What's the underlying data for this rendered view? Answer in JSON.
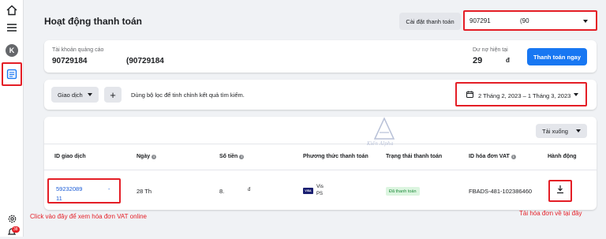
{
  "colors": {
    "accent": "#1877f2",
    "highlight": "#e41e26",
    "status_green": "#1d8a3a",
    "link": "#1a5bd6"
  },
  "sidebar": {
    "icons": [
      "home-icon",
      "menu-icon",
      "avatar",
      "billing-icon",
      "settings-icon",
      "notifications-icon"
    ],
    "avatar_letter": "K",
    "notification_count": "38"
  },
  "header": {
    "title": "Hoạt động thanh toán",
    "settings_label": "Cài đặt thanh toán",
    "account_select_id": "907291",
    "account_select_suffix": "(90"
  },
  "account": {
    "label": "Tài khoản quảng cáo",
    "id": "90729184",
    "name": "(90729184",
    "debt_label": "Dư nợ hiện tại",
    "debt_value": "29",
    "debt_currency": "đ",
    "pay_button": "Thanh toán ngay"
  },
  "filter": {
    "type_label": "Giao dịch",
    "add_label": "+",
    "hint": "Dùng bộ lọc để tinh chỉnh kết quả tìm kiếm.",
    "date_range": "2 Tháng 2, 2023 – 1 Tháng 3, 2023"
  },
  "table": {
    "download_label": "Tải xuống",
    "columns": [
      "ID giao dịch",
      "Ngày",
      "Số tiền",
      "Phương thức thanh toán",
      "Trạng thái thanh toán",
      "ID hóa đơn VAT",
      "Hành động"
    ],
    "row": {
      "txn_id_line1": "59232089",
      "txn_dash": "-",
      "txn_id_line2": "11",
      "date": "28 Th",
      "amount": "8.",
      "amount_suffix": "đ",
      "card_brand": "VISA",
      "card_line1": "Vis",
      "card_line2": "PS",
      "status": "Đã thanh toán",
      "vat_id": "FBADS-481-102386460"
    }
  },
  "watermark": {
    "text": "Kiến Alpha"
  },
  "annotations": {
    "left": "Click vào đây để xem hóa đơn VAT online",
    "right": "Tải hóa đơn về tại đây"
  }
}
